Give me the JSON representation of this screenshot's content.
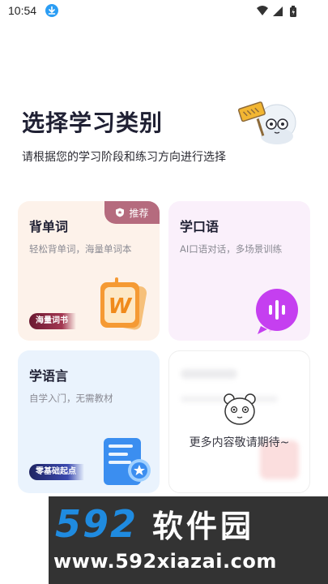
{
  "status_bar": {
    "time": "10:54",
    "icons": [
      "download-icon",
      "wifi-icon",
      "signal-icon",
      "battery-icon"
    ]
  },
  "header": {
    "title": "选择学习类别",
    "subtitle": "请根据您的学习阶段和练习方向进行选择"
  },
  "cards": [
    {
      "title": "背单词",
      "desc": "轻松背单词，海量单词本",
      "badge": "推荐",
      "tag": "海量词书",
      "icon": "w-book-icon",
      "color": "#fdf2ea"
    },
    {
      "title": "学口语",
      "desc": "AI口语对话，多场景训练",
      "icon": "voice-bubble-icon",
      "color": "#faf0fb"
    },
    {
      "title": "学语言",
      "desc": "自学入门，无需教材",
      "tag": "零基础起点",
      "icon": "certificate-icon",
      "color": "#eaf3fd"
    },
    {
      "title": "更多内容敬请期待~",
      "icon": "bear-icon"
    }
  ],
  "watermark": {
    "brand_num": "592",
    "brand_cn": "软件园",
    "url": "www.592xiazai.com"
  },
  "colors": {
    "accent_badge": "#b56b7e",
    "primary_text": "#1f2033",
    "watermark_blue": "#1f8be0"
  }
}
